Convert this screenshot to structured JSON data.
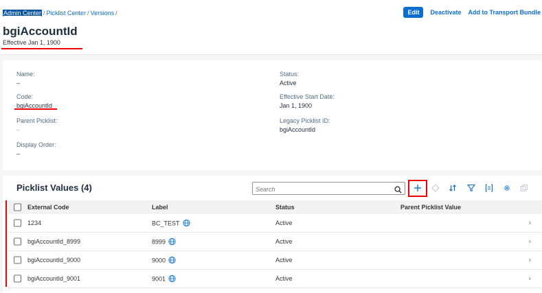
{
  "breadcrumb": {
    "items": [
      "Admin Center",
      "Picklist Center",
      "Versions"
    ],
    "separator": "/"
  },
  "actions": {
    "edit": "Edit",
    "deactivate": "Deactivate",
    "transport": "Add to Transport Bundle"
  },
  "header": {
    "title": "bgiAccountId",
    "subtitle": "Effective Jan 1, 1900"
  },
  "details": {
    "name_label": "Name:",
    "name_value": "–",
    "code_label": "Code:",
    "code_value": "bgiAccountId",
    "parent_label": "Parent Picklist:",
    "parent_value": "–",
    "display_order_label": "Display Order:",
    "display_order_value": "–",
    "status_label": "Status:",
    "status_value": "Active",
    "start_date_label": "Effective Start Date:",
    "start_date_value": "Jan 1, 1900",
    "legacy_label": "Legacy Picklist ID:",
    "legacy_value": "bgiAccountId"
  },
  "picklist": {
    "title": "Picklist Values (4)",
    "search_placeholder": "Search",
    "columns": [
      "External Code",
      "Label",
      "Status",
      "Parent Picklist Value"
    ],
    "rows": [
      {
        "code": "1234",
        "label": "BC_TEST",
        "status": "Active",
        "parent": ""
      },
      {
        "code": "bgiAccountId_8999",
        "label": "8999",
        "status": "Active",
        "parent": ""
      },
      {
        "code": "bgiAccountId_9000",
        "label": "9000",
        "status": "Active",
        "parent": ""
      },
      {
        "code": "bgiAccountId_9001",
        "label": "9001",
        "status": "Active",
        "parent": ""
      }
    ]
  },
  "icons": [
    "search-icon",
    "add-icon",
    "diamond-icon",
    "sort-icon",
    "filter-icon",
    "group-icon",
    "settings-icon",
    "copy-icon",
    "globe-icon",
    "chevron-right-icon"
  ],
  "colors": {
    "accent": "#0a6ed1",
    "highlight": "#ee0000"
  }
}
